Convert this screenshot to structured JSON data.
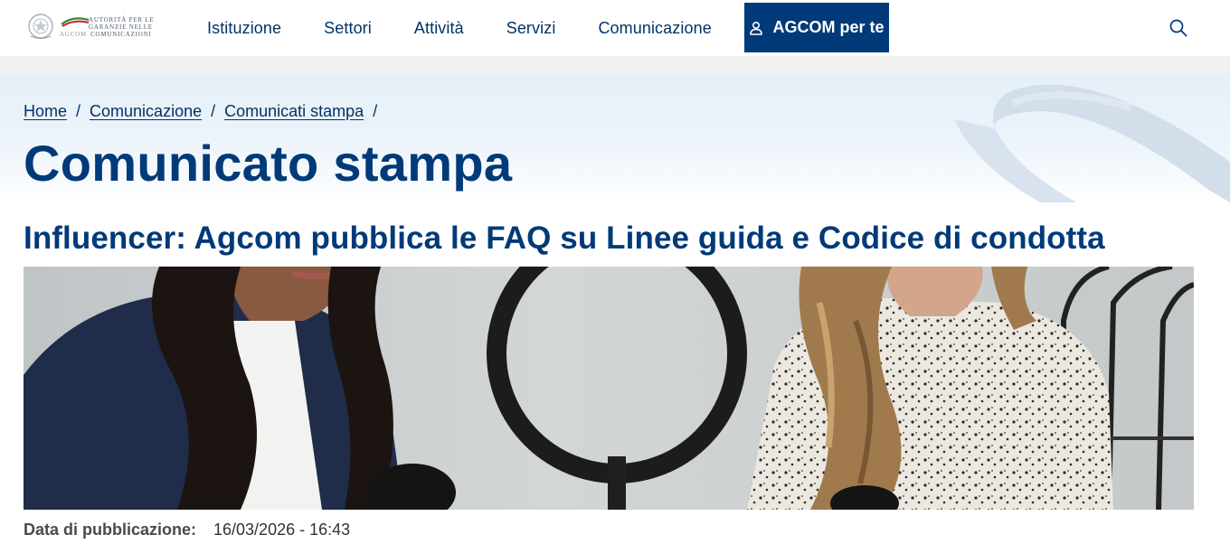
{
  "header": {
    "logo": {
      "line1": "AUTORITÀ PER LE",
      "line2": "GARANZIE NELLE",
      "line3": "COMUNICAZIONI",
      "wordmark": "AGCOM"
    },
    "nav": [
      {
        "label": "Istituzione"
      },
      {
        "label": "Settori"
      },
      {
        "label": "Attività"
      },
      {
        "label": "Servizi"
      },
      {
        "label": "Comunicazione"
      }
    ],
    "cta": {
      "label": "AGCOM per te",
      "icon": "user-icon"
    },
    "search": {
      "icon": "search-icon"
    }
  },
  "breadcrumb": [
    {
      "label": "Home"
    },
    {
      "label": "Comunicazione"
    },
    {
      "label": "Comunicati stampa"
    }
  ],
  "breadcrumb_separator": "/",
  "page_title": "Comunicato stampa",
  "article": {
    "title": "Influencer: Agcom pubblica le FAQ su Linee guida e Codice di condotta",
    "image_description": "photo-two-women-ring-light-microphones",
    "pub_label": "Data di pubblicazione:",
    "pub_value": "16/03/2026 - 16:43"
  },
  "colors": {
    "primary": "#003a78",
    "text": "#003366",
    "hero_bg": "#e6f0f8",
    "strip": "#f0f0f0"
  }
}
